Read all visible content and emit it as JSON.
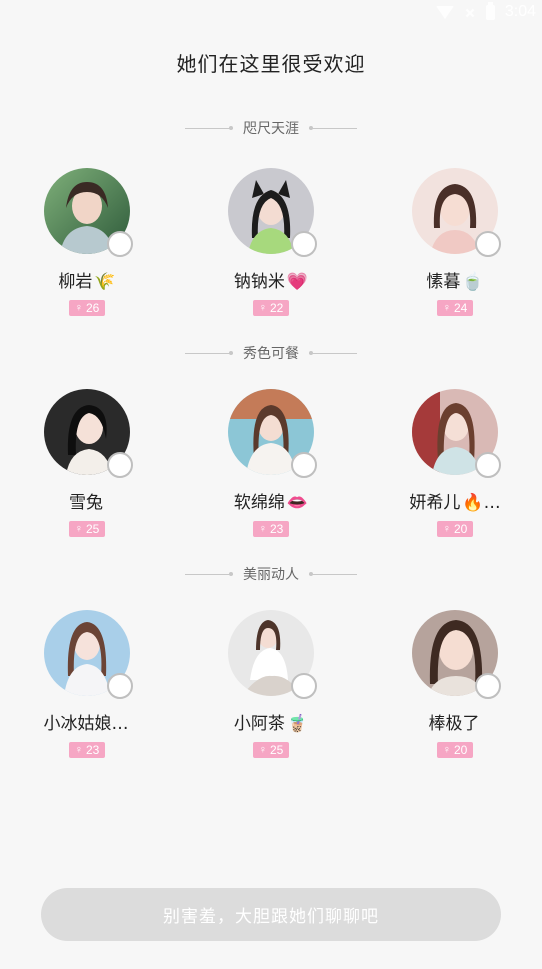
{
  "status_bar": {
    "time": "3:04",
    "icons": [
      "wifi-icon",
      "signal-off-icon",
      "battery-icon"
    ]
  },
  "page_title": "她们在这里很受欢迎",
  "groups": [
    {
      "title": "咫尺天涯",
      "users": [
        {
          "name": "柳岩",
          "emoji": "🌾",
          "age": "26"
        },
        {
          "name": "钠钠米",
          "emoji": "💗",
          "age": "22"
        },
        {
          "name": "愫暮",
          "emoji": "🍵",
          "age": "24"
        }
      ]
    },
    {
      "title": "秀色可餐",
      "users": [
        {
          "name": "雪兔",
          "emoji": "",
          "age": "25"
        },
        {
          "name": "软绵绵",
          "emoji": "👄",
          "age": "23"
        },
        {
          "name": "妍希儿",
          "emoji": "🔥…",
          "age": "20"
        }
      ]
    },
    {
      "title": "美丽动人",
      "users": [
        {
          "name": "小冰姑娘…",
          "emoji": "",
          "age": "23"
        },
        {
          "name": "小阿茶",
          "emoji": "🧋",
          "age": "25"
        },
        {
          "name": "棒极了",
          "emoji": "",
          "age": "20"
        }
      ]
    }
  ],
  "female_symbol": "♀",
  "cta_label": "别害羞，大胆跟她们聊聊吧",
  "colors": {
    "badge": "#f6a6c4",
    "cta_bg": "#dcdcdc",
    "background": "#f7f7f7"
  }
}
